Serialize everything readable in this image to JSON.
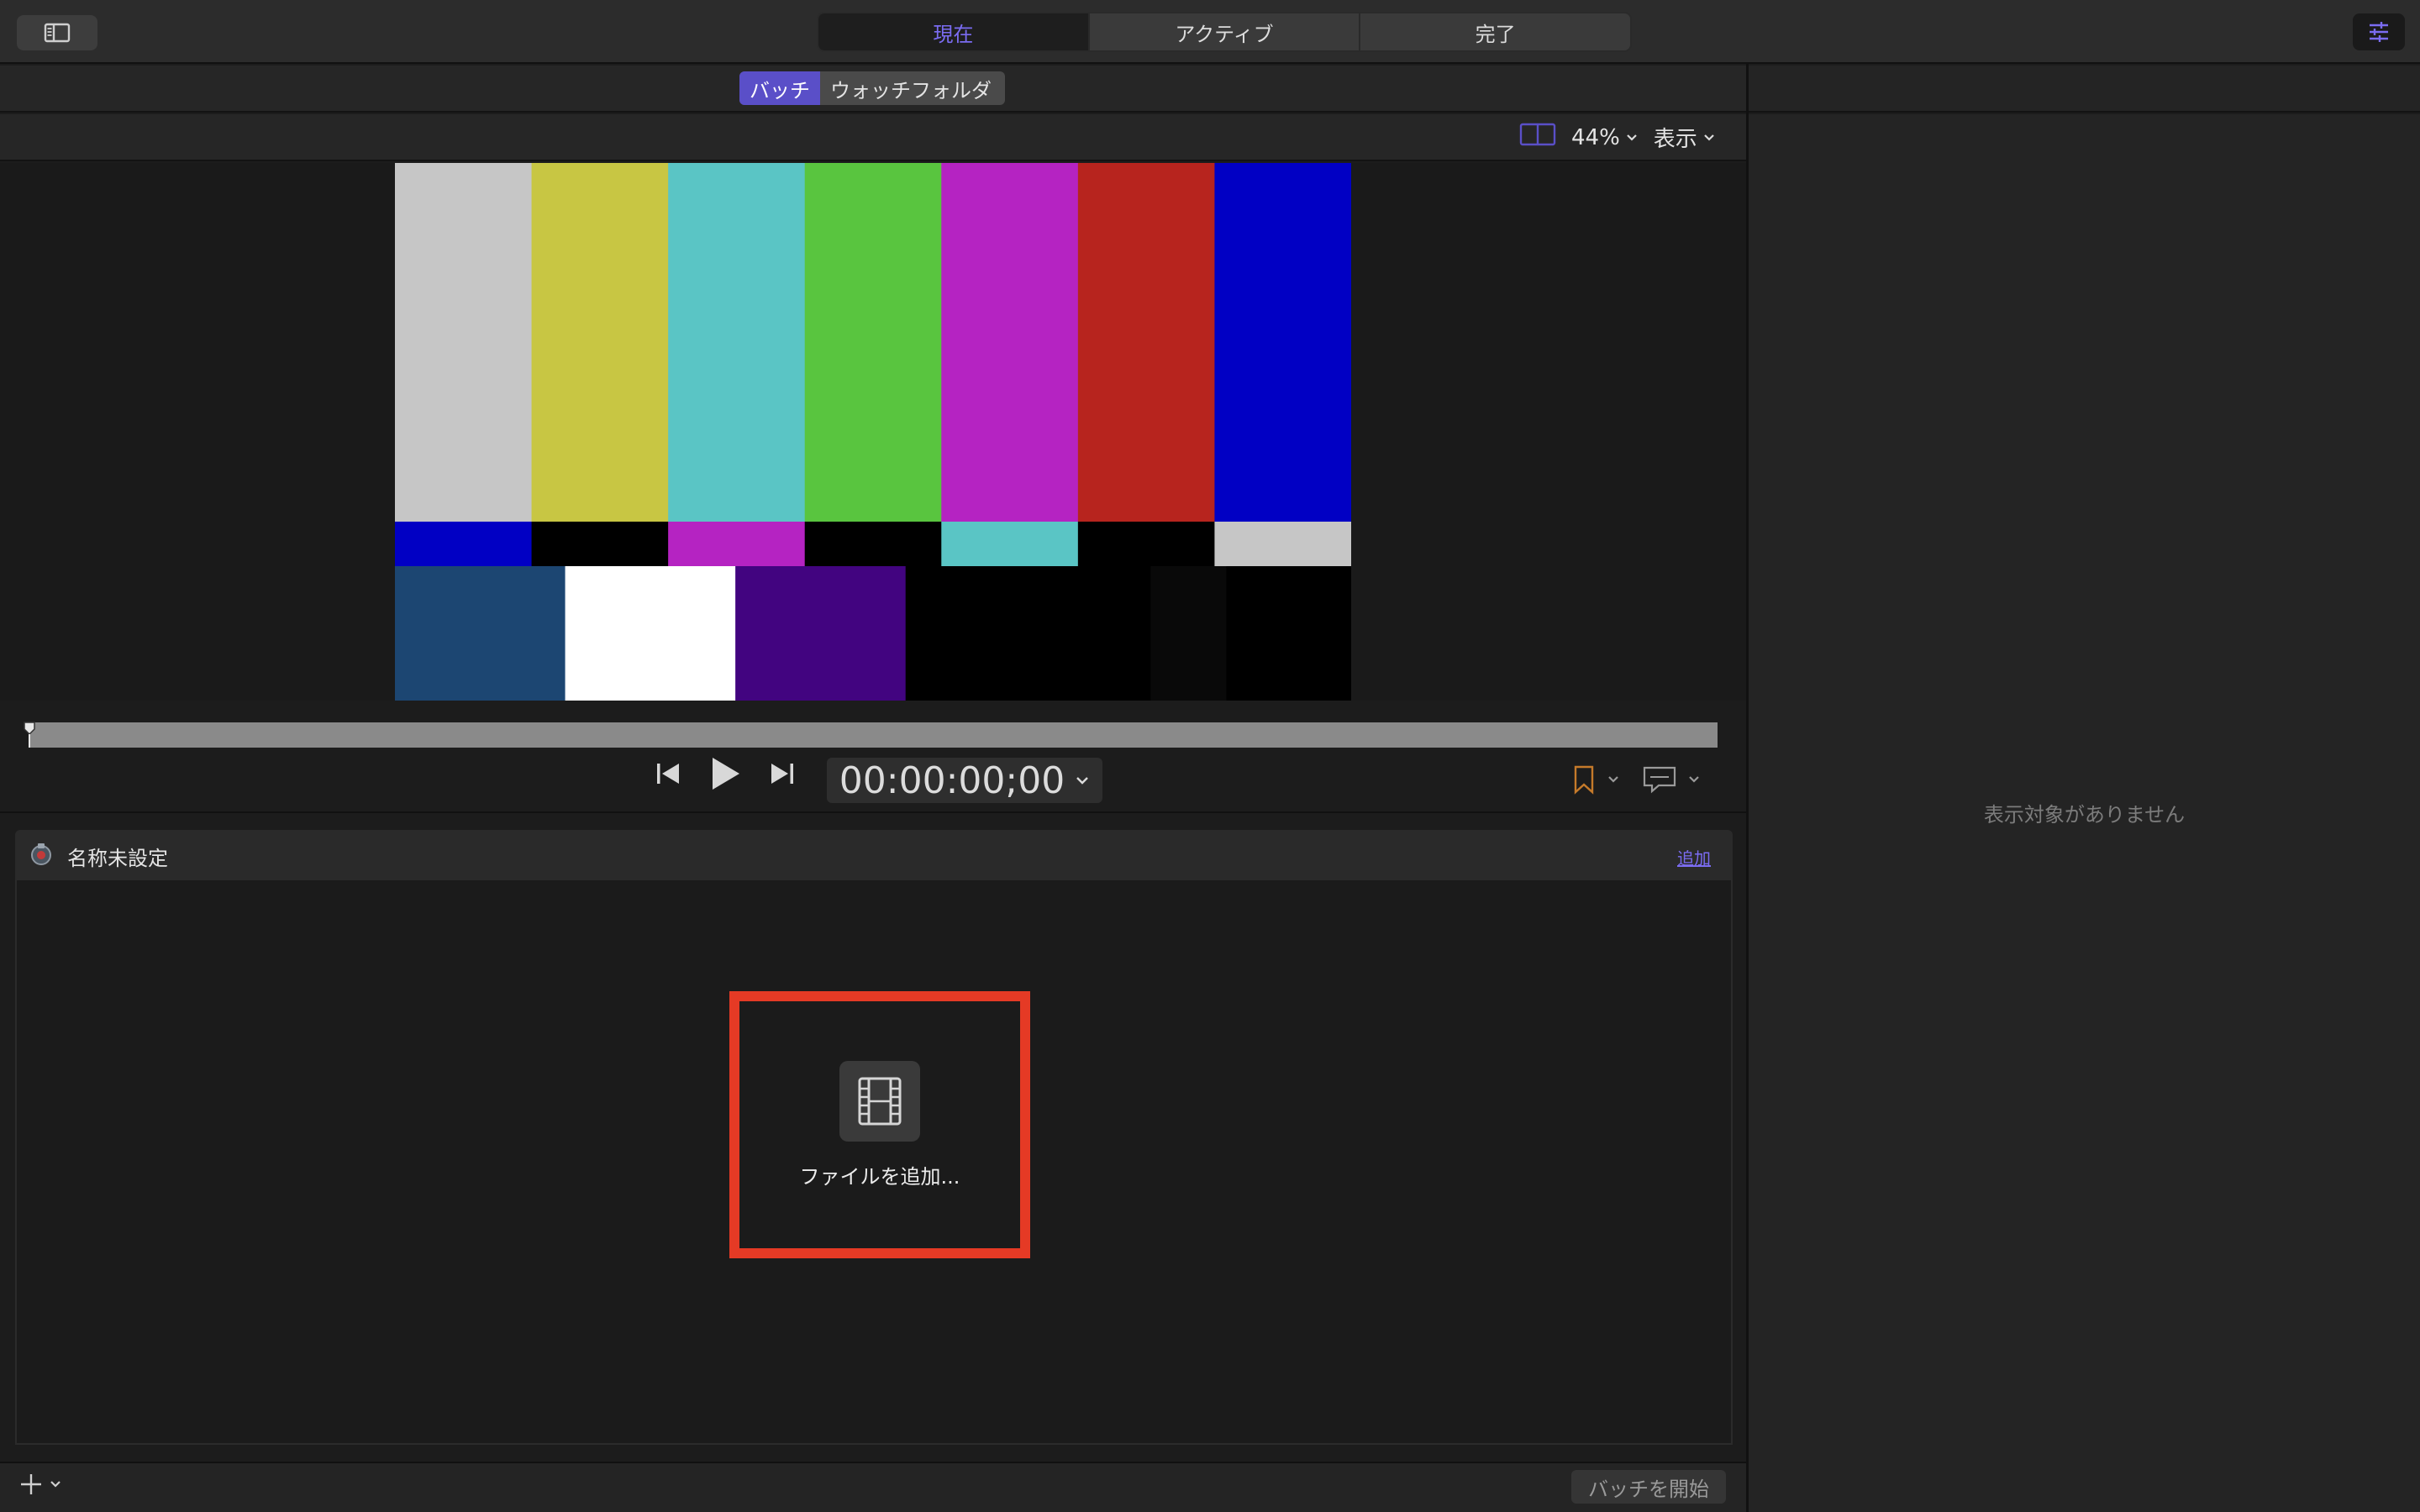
{
  "toolbar": {
    "tabs": [
      {
        "label": "現在",
        "active": true
      },
      {
        "label": "アクティブ",
        "active": false
      },
      {
        "label": "完了",
        "active": false
      }
    ]
  },
  "subtabs": {
    "batch": "バッチ",
    "watch_folder": "ウォッチフォルダ"
  },
  "viewer": {
    "zoom": "44%",
    "view_menu": "表示",
    "test_pattern": {
      "top": [
        "#c6c6c6",
        "#c8c643",
        "#5ac5c5",
        "#59c53f",
        "#b523c2",
        "#b7241e",
        "#0100c4"
      ],
      "middle": [
        "#0100c4",
        "#000000",
        "#b523c2",
        "#000000",
        "#5ac5c5",
        "#000000",
        "#c6c6c6"
      ],
      "bottom": [
        "#1c4672",
        "#ffffff",
        "#420480",
        "#000000",
        "#000000",
        "#090909",
        "#000000"
      ]
    }
  },
  "transport": {
    "timecode": "00:00:00;00"
  },
  "batch": {
    "title": "名称未設定",
    "add_link": "追加",
    "add_files_label": "ファイルを追加..."
  },
  "inspector": {
    "empty_message": "表示対象がありません"
  },
  "footer": {
    "start_batch": "バッチを開始"
  },
  "colors": {
    "accent": "#7b6cf2",
    "highlight_border": "#e53a25"
  }
}
